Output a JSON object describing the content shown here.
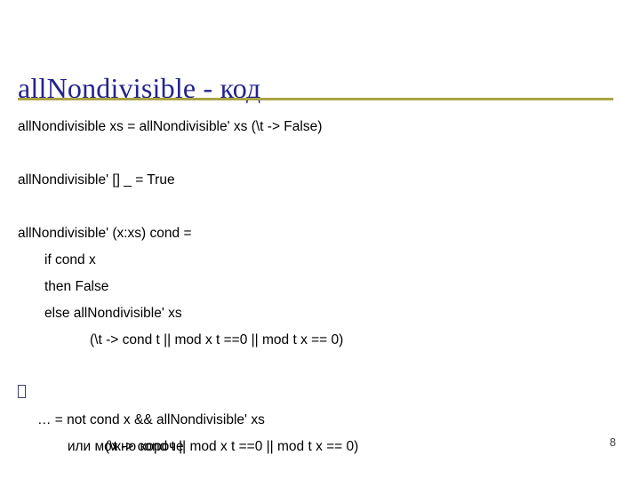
{
  "slide": {
    "title": "allNondivisible - код",
    "page_number": "8",
    "colors": {
      "title": "#23238E",
      "rule": "#A8A544",
      "body_text": "#000000",
      "bullet": "#3F3F6E",
      "background": "#FFFFFF"
    },
    "code_lines": [
      {
        "text": "allNondivisible xs = allNondivisible' xs (\\t -> False)",
        "indent": 0
      },
      {
        "text": "",
        "indent": 0
      },
      {
        "text": "allNondivisible' [] _ = True",
        "indent": 0
      },
      {
        "text": "",
        "indent": 0
      },
      {
        "text": "allNondivisible' (x:xs) cond =",
        "indent": 0
      },
      {
        "text": "if cond x",
        "indent": 1
      },
      {
        "text": "then False",
        "indent": 1
      },
      {
        "text": "else allNondivisible' xs",
        "indent": 1
      },
      {
        "text": "(\\t -> cond t || mod x t ==0 || mod t x == 0)",
        "indent": 3
      },
      {
        "text": "",
        "indent": 0
      }
    ],
    "bullet_item": {
      "marker": "hollow-square-bullet",
      "label": "или можно короче"
    },
    "tail_lines": [
      {
        "text": "… = not cond x && allNondivisible' xs",
        "indent": 2
      },
      {
        "text": "(\\t -> cond t || mod x t ==0 || mod t x == 0)",
        "indent": 4
      }
    ]
  }
}
